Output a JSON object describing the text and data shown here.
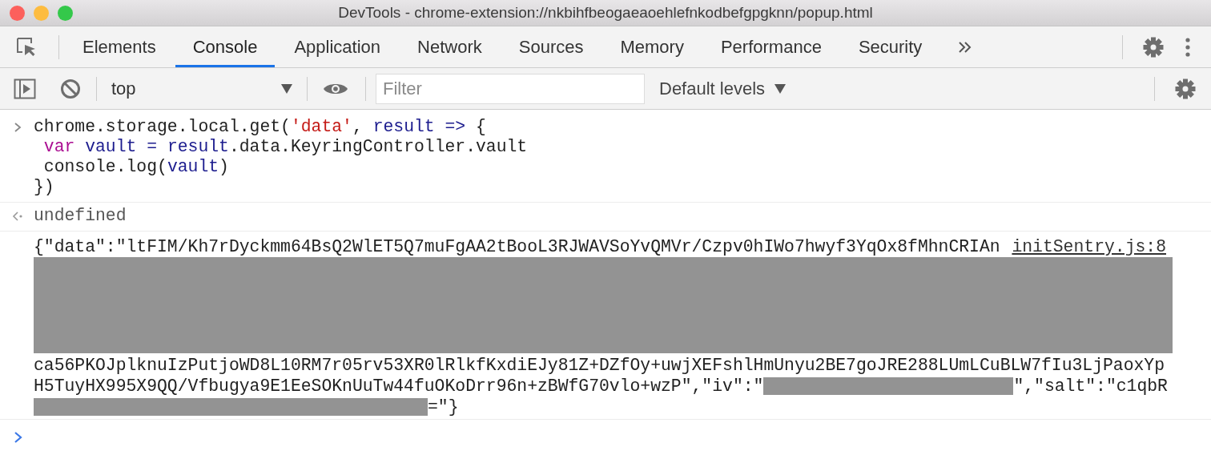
{
  "window": {
    "title": "DevTools - chrome-extension://nkbihfbeogaeaoehlefnkodbefgpgknn/popup.html"
  },
  "tabs": [
    {
      "label": "Elements",
      "selected": false
    },
    {
      "label": "Console",
      "selected": true
    },
    {
      "label": "Application",
      "selected": false
    },
    {
      "label": "Network",
      "selected": false
    },
    {
      "label": "Sources",
      "selected": false
    },
    {
      "label": "Memory",
      "selected": false
    },
    {
      "label": "Performance",
      "selected": false
    },
    {
      "label": "Security",
      "selected": false
    }
  ],
  "console_toolbar": {
    "context": "top",
    "filter": {
      "placeholder": "Filter"
    },
    "levels": "Default levels"
  },
  "console": {
    "messages": [
      {
        "kind": "input",
        "lines": [
          [
            {
              "kind": "plain",
              "text": "chrome.storage.local.get("
            },
            {
              "kind": "string",
              "text": "'data'"
            },
            {
              "kind": "plain",
              "text": ", "
            },
            {
              "kind": "name",
              "text": "result =>"
            },
            {
              "kind": "plain",
              "text": " {"
            }
          ],
          [
            {
              "kind": "keyword",
              "text": " var"
            },
            {
              "kind": "name",
              "text": " vault = result"
            },
            {
              "kind": "plain",
              "text": ".data.KeyringController.vault"
            }
          ],
          [
            {
              "kind": "plain",
              "text": " console.log("
            },
            {
              "kind": "name",
              "text": "vault"
            },
            {
              "kind": "plain",
              "text": ")"
            }
          ],
          [
            {
              "kind": "plain",
              "text": "})"
            }
          ]
        ]
      },
      {
        "kind": "result",
        "text": "undefined"
      },
      {
        "kind": "log",
        "source": "initSentry.js:8",
        "lines": [
          [
            {
              "kind": "text",
              "text": "{\"data\":\"ltFIM/Kh7rDyckmm64BsQ2WlET5Q7muFgAA2tBooL3RJWAVSoYvQMVr/Czpv0hIWo7hwyf3YqOx8fMhnCRIAn"
            }
          ],
          [
            {
              "kind": "redacted_block"
            }
          ],
          [
            {
              "kind": "text",
              "text": "ca56PKOJplknuIzPutjoWD8L10RM7r05rv53XR0lRlkfKxdiEJy81Z+DZfOy+uwjXEFshlHmUnyu2BE7goJRE288LUmLCuBLW7fIu3LjPaoxYp"
            }
          ],
          [
            {
              "kind": "text",
              "text": "H5TuyHX995X9QQ/Vfbugya9E1EeSOKnUuTw44fuOKoDrr96n+zBWfG70vlo+wzP\",\"iv\":\""
            },
            {
              "kind": "redacted"
            },
            {
              "kind": "text",
              "text": "\",\"salt\":\"c1qbR"
            }
          ],
          [
            {
              "kind": "redacted"
            },
            {
              "kind": "text",
              "text": "=\"}"
            }
          ]
        ]
      }
    ]
  }
}
